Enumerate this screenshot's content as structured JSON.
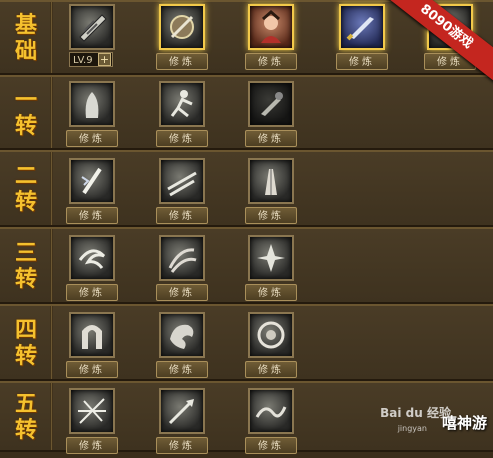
{
  "rows": [
    {
      "label": [
        "基",
        "础"
      ],
      "skills": [
        {
          "btn": "修炼",
          "icon": "blade-scroll-icon",
          "style": "normal"
        },
        {
          "btn": "修炼",
          "icon": "bow-shield-icon",
          "style": "gold"
        },
        {
          "btn": "修炼",
          "icon": "warrior-portrait-icon",
          "style": "gold"
        },
        {
          "btn": "修炼",
          "icon": "sword-icon",
          "style": "gold"
        },
        {
          "btn": "修炼",
          "icon": "partial-icon",
          "style": "gold"
        }
      ]
    },
    {
      "label": [
        "一",
        "转"
      ],
      "skills": [
        {
          "btn": "修炼",
          "icon": "ghost-figure-icon",
          "style": "normal"
        },
        {
          "btn": "修炼",
          "icon": "running-fighter-icon",
          "style": "normal"
        },
        {
          "btn": "修炼",
          "icon": "hilt-icon",
          "style": "locked"
        }
      ]
    },
    {
      "label": [
        "二",
        "转"
      ],
      "skills": [
        {
          "btn": "修炼",
          "icon": "lightning-sword-icon",
          "style": "normal"
        },
        {
          "btn": "修炼",
          "icon": "dual-slash-icon",
          "style": "normal"
        },
        {
          "btn": "修炼",
          "icon": "praying-hands-icon",
          "style": "normal"
        }
      ]
    },
    {
      "label": [
        "三",
        "转"
      ],
      "skills": [
        {
          "btn": "修炼",
          "icon": "wind-swirl-icon",
          "style": "normal"
        },
        {
          "btn": "修炼",
          "icon": "whirlwind-icon",
          "style": "normal"
        },
        {
          "btn": "修炼",
          "icon": "crystal-burst-icon",
          "style": "normal"
        }
      ]
    },
    {
      "label": [
        "四",
        "转"
      ],
      "skills": [
        {
          "btn": "修炼",
          "icon": "arch-icon",
          "style": "normal"
        },
        {
          "btn": "修炼",
          "icon": "dragon-head-icon",
          "style": "normal"
        },
        {
          "btn": "修炼",
          "icon": "shield-disc-icon",
          "style": "normal"
        }
      ]
    },
    {
      "label": [
        "五",
        "转"
      ],
      "skills": [
        {
          "btn": "修炼",
          "icon": "storm-slash-icon",
          "style": "normal"
        },
        {
          "btn": "修炼",
          "icon": "spear-burst-icon",
          "style": "normal"
        },
        {
          "btn": "修炼",
          "icon": "wave-strike-icon",
          "style": "normal"
        }
      ]
    }
  ],
  "level": "LV.9",
  "badge": "8090游戏",
  "watermark": {
    "line1": "Bai du 经验",
    "line2": "jingyan",
    "brand": "嘻神游"
  }
}
